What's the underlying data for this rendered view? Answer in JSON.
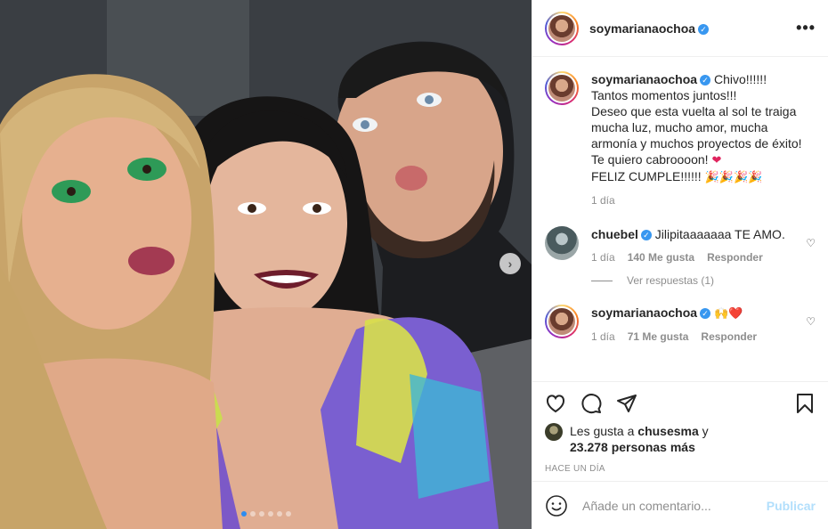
{
  "header": {
    "username": "soymarianaochoa",
    "more_label": "•••"
  },
  "caption": {
    "username": "soymarianaochoa",
    "line1": "Chivo!!!!!!",
    "line2": "Tantos momentos juntos!!!",
    "line3": "Deseo que esta vuelta al sol te traiga mucha luz, mucho amor, mucha armonía y muchos proyectos de éxito!",
    "line4": "Te quiero cabroooon!",
    "line5": "FELIZ CUMPLE!!!!!!",
    "time": "1 día"
  },
  "comments": [
    {
      "username": "chuebel",
      "text": "Jilipitaaaaaaa TE AMO.",
      "time": "1 día",
      "likes": "140 Me gusta",
      "reply": "Responder",
      "view_replies": "Ver respuestas (1)"
    },
    {
      "username": "soymarianaochoa",
      "text": "🙌❤️",
      "time": "1 día",
      "likes": "71 Me gusta",
      "reply": "Responder"
    }
  ],
  "likes_info": {
    "prefix": "Les gusta a",
    "user": "chusesma",
    "suffix": "y",
    "count": "23.278 personas más"
  },
  "timestamp": "HACE UN DÍA",
  "add_comment": {
    "placeholder": "Añade un comentario...",
    "publish": "Publicar"
  },
  "carousel": {
    "total": 6,
    "active": 1
  },
  "colors": {
    "accent": "#3897f0",
    "publish_disabled": "#b2dffc",
    "heart": "#e0245e"
  }
}
